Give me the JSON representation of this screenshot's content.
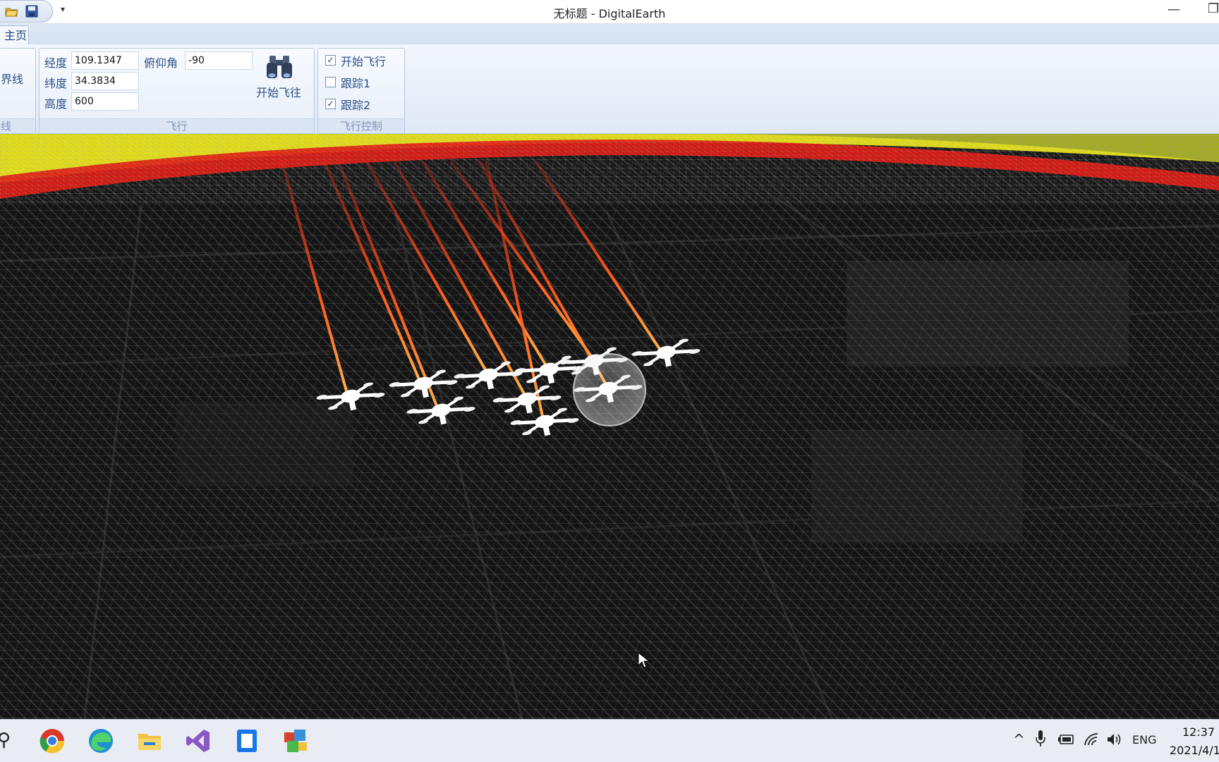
{
  "window": {
    "title": "无标题 - DigitalEarth",
    "qat_dropdown": "▾",
    "minimize": "—",
    "restore": "❐"
  },
  "ribbon": {
    "tab_home": "主页",
    "partial_group": {
      "button_label": "界线",
      "footer_label": "线"
    },
    "flight_group": {
      "label": "飞行",
      "longitude_label": "经度",
      "longitude_value": "109.1347",
      "latitude_label": "纬度",
      "latitude_value": "34.3834",
      "altitude_label": "高度",
      "altitude_value": "600",
      "pitch_label": "俯仰角",
      "pitch_value": "-90",
      "fly_to_button": "开始飞往"
    },
    "control_group": {
      "label": "飞行控制",
      "options": [
        {
          "label": "开始飞行",
          "checked": true,
          "mark": "✓"
        },
        {
          "label": "跟踪1",
          "checked": false,
          "mark": ""
        },
        {
          "label": "跟踪2",
          "checked": true,
          "mark": "✓"
        }
      ]
    }
  },
  "scene": {
    "drone_count": 10,
    "trail_colors": [
      "#ff3b1a",
      "#ffa63a"
    ],
    "band_colors": {
      "yellow": "#f2ee1a",
      "red": "#e11a12",
      "grid": "#ffffff",
      "ground": "#121212"
    }
  },
  "taskbar": {
    "search_glyph": "⚲",
    "apps": [
      "chrome-icon",
      "edge-icon",
      "file-explorer-icon",
      "visual-studio-icon",
      "notepad-icon",
      "digitalearth-app-icon"
    ],
    "tray": {
      "chevron": "^",
      "language": "ENG",
      "time": "12:37",
      "date": "2021/4/1"
    }
  }
}
